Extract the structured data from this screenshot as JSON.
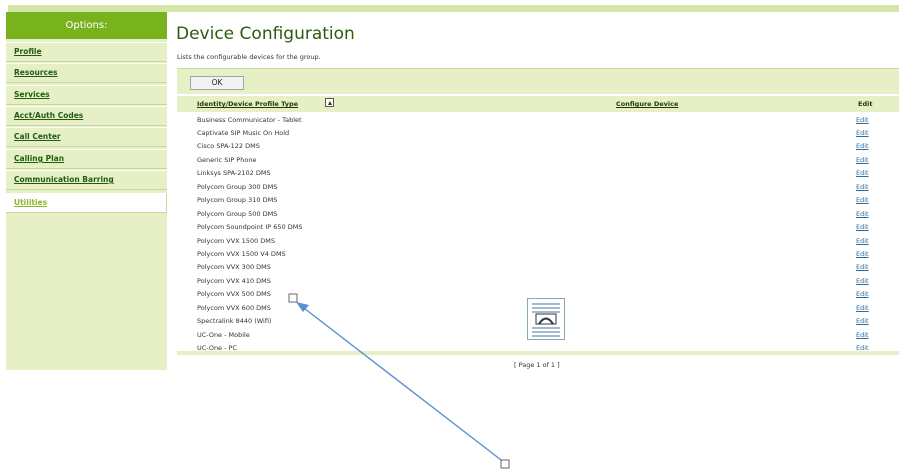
{
  "sidebar": {
    "header": "Options:",
    "items": [
      {
        "label": "Profile"
      },
      {
        "label": "Resources"
      },
      {
        "label": "Services"
      },
      {
        "label": "Acct/Auth Codes"
      },
      {
        "label": "Call Center"
      },
      {
        "label": "Calling Plan"
      },
      {
        "label": "Communication Barring"
      },
      {
        "label": "Utilities",
        "active": true
      }
    ]
  },
  "main": {
    "title": "Device Configuration",
    "subtitle": "Lists the configurable devices for the group.",
    "ok_label": "OK",
    "table": {
      "headers": {
        "type": "Identity/Device Profile Type",
        "configure": "Configure Device",
        "edit": "Edit"
      },
      "rows": [
        {
          "name": "Business Communicator - Tablet",
          "edit": "Edit"
        },
        {
          "name": "Captivate SIP Music On Hold",
          "edit": "Edit"
        },
        {
          "name": "Cisco SPA-122 DMS",
          "edit": "Edit"
        },
        {
          "name": "Generic SIP Phone",
          "edit": "Edit"
        },
        {
          "name": "Linksys SPA-2102 DMS",
          "edit": "Edit"
        },
        {
          "name": "Polycom Group 300 DMS",
          "edit": "Edit"
        },
        {
          "name": "Polycom Group 310 DMS",
          "edit": "Edit"
        },
        {
          "name": "Polycom Group 500 DMS",
          "edit": "Edit"
        },
        {
          "name": "Polycom Soundpoint IP 650 DMS",
          "edit": "Edit"
        },
        {
          "name": "Polycom VVX 1500 DMS",
          "edit": "Edit"
        },
        {
          "name": "Polycom VVX 1500 V4 DMS",
          "edit": "Edit"
        },
        {
          "name": "Polycom VVX 300 DMS",
          "edit": "Edit"
        },
        {
          "name": "Polycom VVX 410 DMS",
          "edit": "Edit"
        },
        {
          "name": "Polycom VVX 500 DMS",
          "edit": "Edit"
        },
        {
          "name": "Polycom VVX 600 DMS",
          "edit": "Edit"
        },
        {
          "name": "Spectralink 8440 (Wifi)",
          "edit": "Edit"
        },
        {
          "name": "UC-One - Mobile",
          "edit": "Edit"
        },
        {
          "name": "UC-One - PC",
          "edit": "Edit"
        }
      ]
    },
    "pager": "[ Page 1 of 1 ]"
  },
  "colors": {
    "accent": "#78b31e",
    "panel": "#e6efc5",
    "link": "#2e6b9e",
    "arrow": "#5b8fd0"
  }
}
